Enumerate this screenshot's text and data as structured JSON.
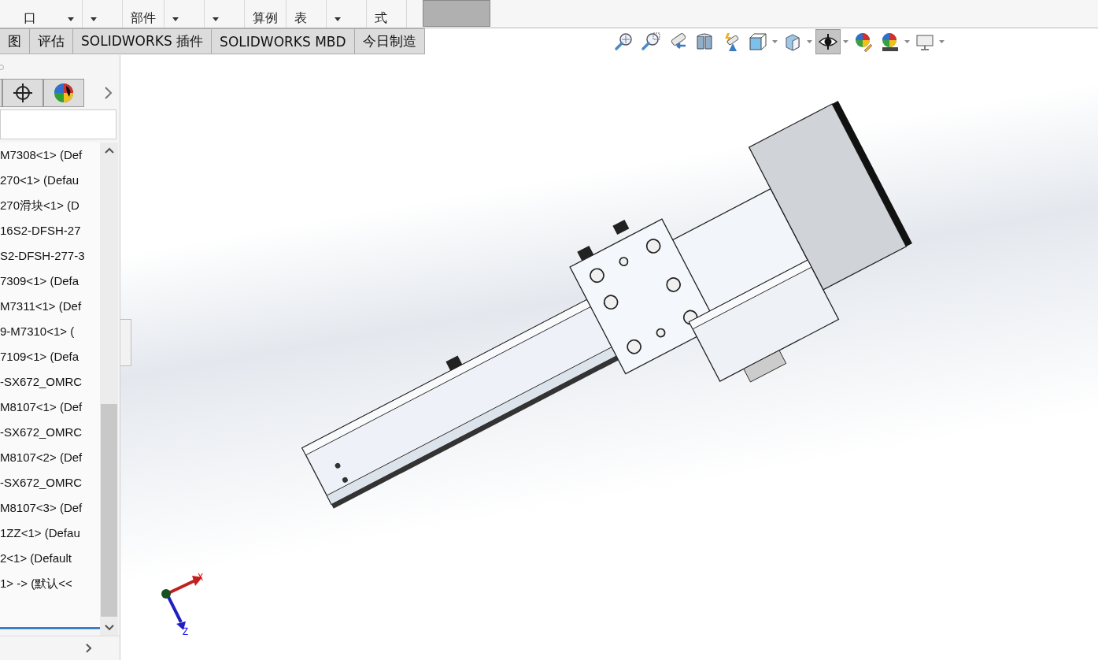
{
  "ribbon": {
    "items": [
      {
        "label": "口",
        "dropdown": true
      },
      {
        "dropdown": true
      },
      {
        "label": "部件",
        "dropdown": false
      },
      {
        "dropdown": true
      },
      {
        "dropdown": true
      },
      {
        "label": "算例",
        "dropdown": false
      },
      {
        "label": "表",
        "dropdown": false
      },
      {
        "dropdown": true
      },
      {
        "label": "式",
        "dropdown": false
      }
    ]
  },
  "tabs": [
    {
      "label": "图",
      "selected": false
    },
    {
      "label": "评估",
      "selected": false
    },
    {
      "label": "SOLIDWORKS 插件",
      "selected": false
    },
    {
      "label": "SOLIDWORKS MBD",
      "selected": false
    },
    {
      "label": "今日制造",
      "selected": false
    }
  ],
  "view_toolbar": [
    {
      "kind": "zoom-fit",
      "active": false,
      "dropdown": false
    },
    {
      "kind": "zoom-area",
      "active": false,
      "dropdown": false
    },
    {
      "kind": "previous-view",
      "active": false,
      "dropdown": false
    },
    {
      "kind": "section-view",
      "active": false,
      "dropdown": false
    },
    {
      "kind": "dynamic-annotation",
      "active": false,
      "dropdown": false
    },
    {
      "kind": "view-orientation",
      "active": false,
      "dropdown": true
    },
    {
      "kind": "display-style",
      "active": false,
      "dropdown": true
    },
    {
      "kind": "hide-show",
      "active": true,
      "dropdown": true
    },
    {
      "kind": "edit-appearance",
      "active": false,
      "dropdown": false
    },
    {
      "kind": "apply-scene",
      "active": false,
      "dropdown": true
    },
    {
      "kind": "view-settings",
      "active": false,
      "dropdown": true
    }
  ],
  "feature_tree": {
    "items": [
      "M7308<1> (Def",
      "270<1> (Defau",
      "270滑块<1> (D",
      "16S2-DFSH-27",
      "S2-DFSH-277-3",
      "7309<1> (Defa",
      "M7311<1> (Def",
      "9-M7310<1> (",
      "7109<1> (Defa",
      "-SX672_OMRC",
      "M8107<1> (Def",
      "-SX672_OMRC",
      "M8107<2> (Def",
      "-SX672_OMRC",
      "M8107<3> (Def",
      "1ZZ<1> (Defau",
      "2<1> (Default",
      "1> -> (默认<<"
    ]
  },
  "triad": {
    "x": "X",
    "z": "Z"
  }
}
